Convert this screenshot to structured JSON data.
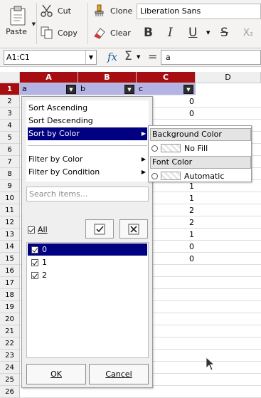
{
  "toolbar": {
    "paste_label": "Paste",
    "cut_label": "Cut",
    "copy_label": "Copy",
    "clone_label": "Clone",
    "clear_label": "Clear",
    "font_name": "Liberation Sans",
    "bold": "B",
    "italic": "I",
    "underline": "U",
    "strikethrough": "S",
    "subscript": "X₂"
  },
  "formula_bar": {
    "name_box": "A1:C1",
    "fx": "fx",
    "sum": "Σ",
    "equals": "=",
    "content": "a"
  },
  "sheet": {
    "columns": [
      "A",
      "B",
      "C",
      "D"
    ],
    "header_row": [
      "a",
      "b",
      "c"
    ],
    "rows": [
      "1",
      "2",
      "3",
      "4",
      "5",
      "6",
      "7",
      "8",
      "9",
      "10",
      "11",
      "12",
      "13",
      "14",
      "15",
      "16",
      "17",
      "18",
      "19",
      "20",
      "21",
      "22",
      "23",
      "24",
      "25",
      "26"
    ],
    "c_values": [
      "0",
      "0",
      "",
      "",
      "",
      "",
      "",
      "1",
      "1",
      "2",
      "2",
      "1",
      "0",
      "0"
    ],
    "accent_color": "#a70e12"
  },
  "popup": {
    "menu": [
      {
        "label": "Sort Ascending"
      },
      {
        "label": "Sort Descending"
      },
      {
        "label": "Sort by Color",
        "has_submenu": true,
        "selected": true
      },
      {
        "label": "Filter by Color",
        "has_submenu": true
      },
      {
        "label": "Filter by Condition",
        "has_submenu": true
      }
    ],
    "search_placeholder": "Search items...",
    "all_label": "All",
    "values": [
      {
        "label": "0",
        "checked": true,
        "selected": true
      },
      {
        "label": "1",
        "checked": true
      },
      {
        "label": "2",
        "checked": true
      }
    ],
    "ok_label": "OK",
    "cancel_label": "Cancel",
    "selection_color": "#000080"
  },
  "submenu": {
    "background_header": "Background Color",
    "background_option": "No Fill",
    "font_header": "Font Color",
    "font_option": "Automatic"
  }
}
